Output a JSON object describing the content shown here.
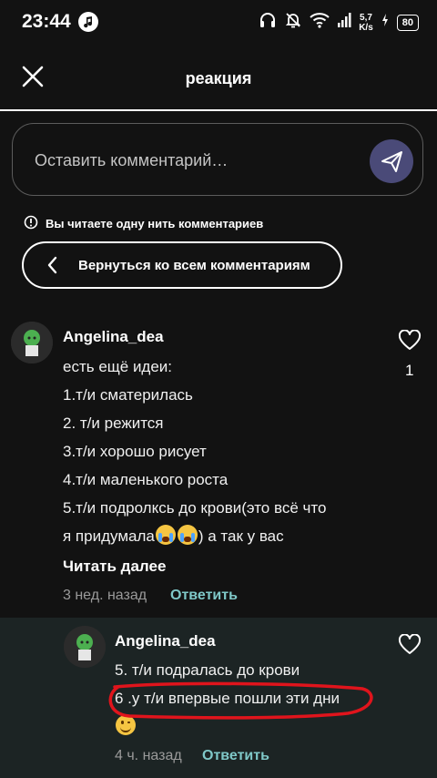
{
  "status_bar": {
    "time": "23:44",
    "net_speed_value": "5,7",
    "net_speed_unit": "K/s",
    "battery": "80"
  },
  "header": {
    "title": "реакция"
  },
  "comment_input": {
    "placeholder": "Оставить комментарий…"
  },
  "thread_info": {
    "text": "Вы читаете одну нить комментариев"
  },
  "back_button": {
    "label": "Вернуться ко всем комментариям"
  },
  "comments": [
    {
      "username": "Angelina_dea",
      "lines": [
        "есть ещё идеи:",
        "1.т/и сматерилась",
        "2. т/и режится",
        "3.т/и хорошо рисует",
        "4.т/и  маленького роста",
        "5.т/и подролксь до крови(это всё что",
        "я придумала",
        ") а так у вас"
      ],
      "read_more": "Читать далее",
      "time": "3 нед. назад",
      "reply": "Ответить",
      "likes": "1"
    },
    {
      "username": "Angelina_dea",
      "lines": [
        "5. т/и подралась до крови",
        "6 .у  т/и впервые пошли эти дни"
      ],
      "time": "4 ч. назад",
      "reply": "Ответить"
    }
  ],
  "colors": {
    "background": "#121212",
    "reply_background": "#1c2424",
    "send_button": "#4a4a78",
    "reply_link": "#7fc8c8",
    "highlight_circle": "#e0141c"
  }
}
